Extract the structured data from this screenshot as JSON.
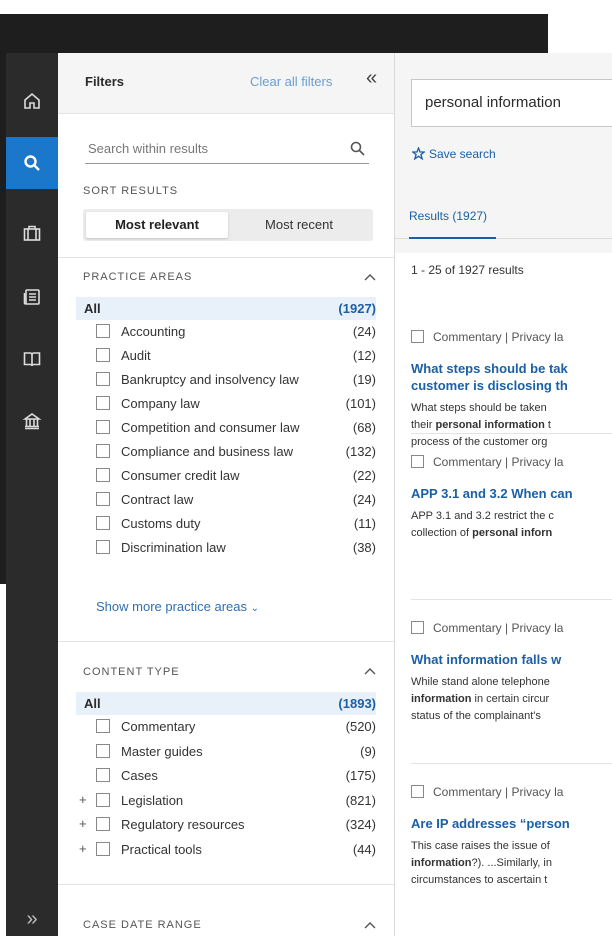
{
  "rail": {
    "items": [
      "home-icon",
      "search-icon",
      "briefcase-icon",
      "news-icon",
      "book-icon",
      "library-icon"
    ],
    "expand_icon": "double-chevron-right-icon",
    "expand_glyph": "»",
    "accent_color": "#1b77c9"
  },
  "filters": {
    "title": "Filters",
    "clear_all": "Clear all filters",
    "collapse_glyph": "«",
    "search_placeholder": "Search within results",
    "sort": {
      "title": "SORT RESULTS",
      "selected": "Most relevant",
      "other": "Most recent"
    },
    "practice_areas": {
      "title": "PRACTICE AREAS",
      "all": {
        "label": "All",
        "count": "(1927)"
      },
      "items": [
        {
          "label": "Accounting",
          "count": "(24)"
        },
        {
          "label": "Audit",
          "count": "(12)"
        },
        {
          "label": "Bankruptcy and insolvency law",
          "count": "(19)"
        },
        {
          "label": "Company law",
          "count": "(101)"
        },
        {
          "label": "Competition and consumer law",
          "count": "(68)"
        },
        {
          "label": "Compliance and business law",
          "count": "(132)"
        },
        {
          "label": "Consumer credit law",
          "count": "(22)"
        },
        {
          "label": "Contract law",
          "count": "(24)"
        },
        {
          "label": "Customs duty",
          "count": "(11)"
        },
        {
          "label": "Discrimination law",
          "count": "(38)"
        }
      ],
      "show_more": "Show more practice areas"
    },
    "content_type": {
      "title": "CONTENT TYPE",
      "all": {
        "label": "All",
        "count": "(1893)"
      },
      "items": [
        {
          "label": "Commentary",
          "count": "(520)",
          "expandable": false
        },
        {
          "label": "Master guides",
          "count": "(9)",
          "expandable": false
        },
        {
          "label": "Cases",
          "count": "(175)",
          "expandable": false
        },
        {
          "label": "Legislation",
          "count": "(821)",
          "expandable": true
        },
        {
          "label": "Regulatory resources",
          "count": "(324)",
          "expandable": true
        },
        {
          "label": "Practical tools",
          "count": "(44)",
          "expandable": true
        }
      ]
    },
    "case_date_range": {
      "title": "CASE DATE RANGE"
    }
  },
  "main": {
    "query": "personal information",
    "save_search": "Save search",
    "tab_label": "Results (1927)",
    "count_text": "1 - 25 of 1927 results",
    "results": [
      {
        "tag": "Commentary | Privacy la",
        "title_lines": [
          "What steps should be tak",
          "customer is disclosing th"
        ],
        "snippet_lines": [
          [
            {
              "t": "What steps should be taken"
            }
          ],
          [
            {
              "t": "their "
            },
            {
              "t": "personal information",
              "b": true
            },
            {
              "t": " t"
            }
          ],
          [
            {
              "t": "process of the customer org"
            }
          ]
        ]
      },
      {
        "tag": "Commentary | Privacy la",
        "title_lines": [
          "APP 3.1 and 3.2 When can"
        ],
        "snippet_lines": [
          [
            {
              "t": "APP 3.1 and 3.2 restrict the c"
            }
          ],
          [
            {
              "t": "collection of "
            },
            {
              "t": "personal inforn",
              "b": true
            }
          ]
        ]
      },
      {
        "tag": "Commentary | Privacy la",
        "title_lines": [
          "What information falls w"
        ],
        "snippet_lines": [
          [
            {
              "t": "While stand alone telephone"
            }
          ],
          [
            {
              "t": "information",
              "b": true
            },
            {
              "t": " in certain circur"
            }
          ],
          [
            {
              "t": "status of the complainant's"
            }
          ]
        ]
      },
      {
        "tag": "Commentary | Privacy la",
        "title_lines": [
          "Are IP addresses “person"
        ],
        "snippet_lines": [
          [
            {
              "t": "This case raises the issue of"
            }
          ],
          [
            {
              "t": "information",
              "b": true
            },
            {
              "t": "?). ...Similarly, in"
            }
          ],
          [
            {
              "t": "circumstances to ascertain t"
            }
          ]
        ]
      }
    ]
  }
}
